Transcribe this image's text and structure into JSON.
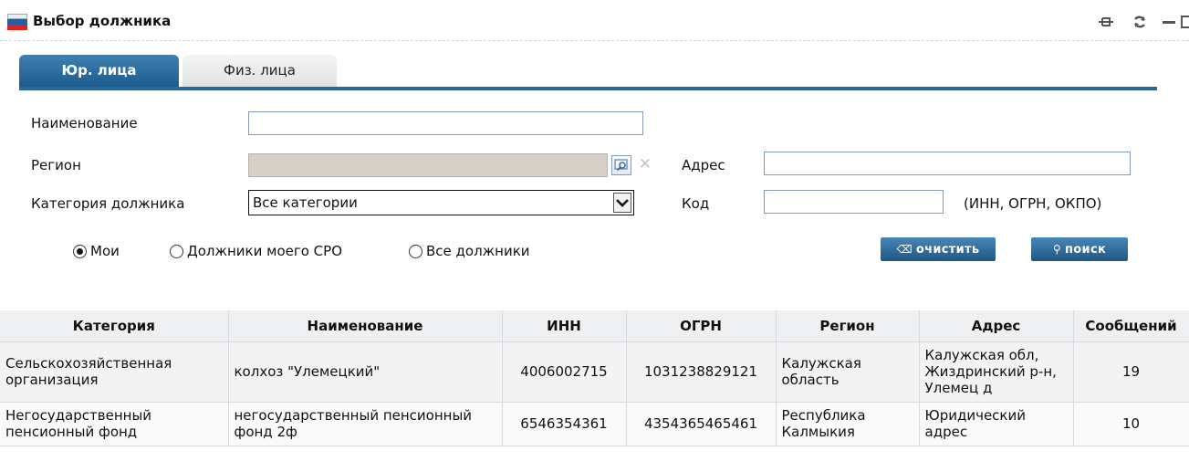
{
  "window": {
    "title": "Выбор должника",
    "controls": [
      "pin-icon",
      "refresh-icon",
      "minimize-icon",
      "maximize-icon"
    ]
  },
  "tabs": [
    {
      "label": "Юр. лица",
      "active": true
    },
    {
      "label": "Физ. лица",
      "active": false
    }
  ],
  "form": {
    "name_label": "Наименование",
    "name_value": "",
    "region_label": "Регион",
    "region_value": "",
    "address_label": "Адрес",
    "address_value": "",
    "category_label": "Категория должника",
    "category_selected": "Все категории",
    "code_label": "Код",
    "code_value": "",
    "code_hint": "(ИНН, ОГРН, ОКПО)",
    "radios": [
      {
        "label": "Мои",
        "checked": true
      },
      {
        "label": "Должники моего СРО",
        "checked": false
      },
      {
        "label": "Все должники",
        "checked": false
      }
    ],
    "clear_button": "очистить",
    "search_button": "поиск"
  },
  "table": {
    "headers": [
      "Категория",
      "Наименование",
      "ИНН",
      "ОГРН",
      "Регион",
      "Адрес",
      "Сообщений"
    ],
    "rows": [
      [
        "Сельскохозяйственная организация",
        "колхоз \"Улемецкий\"",
        "4006002715",
        "1031238829121",
        "Калужская область",
        "Калужская обл, Жиздринский р-н, Улемец д",
        "19"
      ],
      [
        "Негосударственный пенсионный фонд",
        "негосударственный пенсионный фонд 2ф",
        "6546354361",
        "4354365465461",
        "Республика Калмыкия",
        "Юридический адрес",
        "10"
      ]
    ]
  },
  "colors": {
    "accent": "#1f5d8c",
    "header_bg": "#eef0f2"
  }
}
